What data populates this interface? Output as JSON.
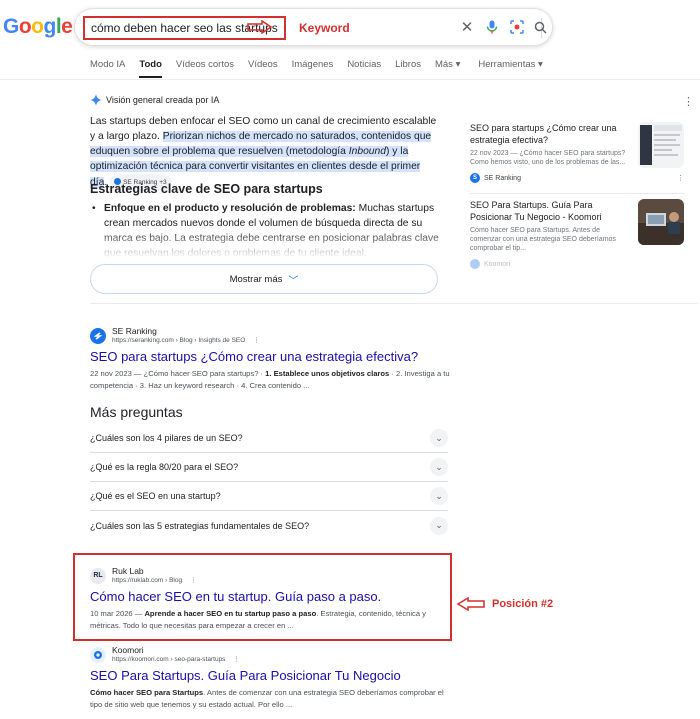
{
  "logo": {
    "letters": [
      "G",
      "o",
      "o",
      "g",
      "l",
      "e"
    ],
    "colors": [
      "#4285f4",
      "#ea4335",
      "#fbbc05",
      "#4285f4",
      "#34a853",
      "#ea4335"
    ]
  },
  "search": {
    "query": "cómo deben hacer seo las startups"
  },
  "annotations": {
    "keyword": "Keyword",
    "position": "Posición #2",
    "color": "#d32f2f"
  },
  "tabs": [
    "Modo IA",
    "Todo",
    "Vídeos cortos",
    "Vídeos",
    "Imágenes",
    "Noticias",
    "Libros",
    "Más ▾",
    "Herramientas ▾"
  ],
  "ai_overview": {
    "header": "Visión general creada por IA",
    "para_plain": "Las startups deben enfocar el SEO como un canal de crecimiento escalable y a largo plazo. ",
    "para_hl_1": "Priorizan nichos de mercado no saturados, contenidos que eduquen sobre el problema que resuelven (metodología ",
    "para_hl_em": "Inbound",
    "para_hl_2": ") y la optimización técnica para convertir visitantes en clientes desde el primer día",
    "para_end": ".",
    "chip": "SE Ranking +3",
    "heading": "Estrategias clave de SEO para startups",
    "bullet_bold": "Enfoque en el producto y resolución de problemas:",
    "bullet_text": " Muchas startups crean mercados nuevos donde el volumen de búsqueda directa de su marca es bajo. La estrategia debe centrarse en posicionar palabras clave que resuelvan los dolores o problemas de tu cliente ideal.",
    "show_more": "Mostrar más"
  },
  "side_sources": [
    {
      "title": "SEO para startups ¿Cómo crear una estrategia efectiva?",
      "snippet": "22 nov 2023 — ¿Cómo hacer SEO para startups? Como hemos visto, uno de los problemas de las...",
      "source": "SE Ranking"
    },
    {
      "title": "SEO Para Startups. Guía Para Posicionar Tu Negocio - Koomori",
      "snippet": "Cómo hacer SEO para Startups. Antes de comenzar con una estrategia SEO deberíamos comprobar el tip...",
      "source": "Koomori"
    }
  ],
  "results": [
    {
      "site": "SE Ranking",
      "url": "https://seranking.com › Blog › Insights de SEO",
      "title": "SEO para startups ¿Cómo crear una estrategia efectiva?",
      "date": "22 nov 2023 — ¿Cómo hacer SEO para startups? · ",
      "bold": "1. Establece unos objetivos claros",
      "rest": " · 2. Investiga a tu competencia · 3. Haz un keyword research · 4. Crea contenido ..."
    },
    {
      "site": "Ruk Lab",
      "fav": "RL",
      "url": "https://ruklab.com › Blog",
      "title": "Cómo hacer SEO en tu startup. Guía paso a paso.",
      "date": "10 mar 2026 — ",
      "bold": "Aprende a hacer SEO en tu startup paso a paso",
      "rest": ". Estrategia, contenido, técnica y métricas. Todo lo que necesitas para empezar a crecer en ..."
    },
    {
      "site": "Koomori",
      "url": "https://koomori.com › seo-para-startups",
      "title": "SEO Para Startups. Guía Para Posicionar Tu Negocio",
      "date": "",
      "bold": "Cómo hacer SEO para Startups",
      "rest": ". Antes de comenzar con una estrategia SEO deberíamos comprobar el tipo de sitio web que tenemos y su estado actual. Por ello ..."
    }
  ],
  "paa": {
    "title": "Más preguntas",
    "questions": [
      "¿Cuáles son los 4 pilares de un SEO?",
      "¿Qué es la regla 80/20 para el SEO?",
      "¿Qué es el SEO en una startup?",
      "¿Cuáles son las 5 estrategias fundamentales de SEO?"
    ]
  }
}
